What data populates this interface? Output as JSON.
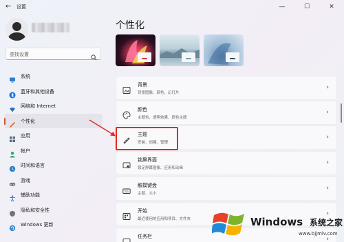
{
  "window": {
    "title": "设置",
    "back_icon": "back-arrow-icon",
    "controls": [
      "minimize",
      "maximize",
      "close"
    ]
  },
  "sidebar": {
    "search_placeholder": "查找设置",
    "items": [
      {
        "label": "系统",
        "icon": "system-icon",
        "color": "#2f7dd1"
      },
      {
        "label": "蓝牙和其他设备",
        "icon": "bluetooth-icon",
        "color": "#1f6fd1"
      },
      {
        "label": "网络和 Internet",
        "icon": "wifi-icon",
        "color": "#2a6fbf"
      },
      {
        "label": "个性化",
        "icon": "brush-icon",
        "color": "#d46b2b",
        "active": true
      },
      {
        "label": "应用",
        "icon": "apps-icon",
        "color": "#5a6a7e"
      },
      {
        "label": "帐户",
        "icon": "account-icon",
        "color": "#2fa36b"
      },
      {
        "label": "时间和语言",
        "icon": "globe-clock-icon",
        "color": "#2a7fc9"
      },
      {
        "label": "游戏",
        "icon": "gamepad-icon",
        "color": "#6b7280"
      },
      {
        "label": "辅助功能",
        "icon": "accessibility-icon",
        "color": "#2c7be5"
      },
      {
        "label": "隐私和安全性",
        "icon": "shield-icon",
        "color": "#6b7280"
      },
      {
        "label": "Windows 更新",
        "icon": "windows-update-icon",
        "color": "#2b88d8"
      }
    ]
  },
  "main": {
    "title": "个性化",
    "cards": [
      {
        "title": "背景",
        "subtitle": "背景图像、颜色、幻灯片",
        "icon": "image-icon"
      },
      {
        "title": "颜色",
        "subtitle": "主题色、透明效果、颜色主题",
        "icon": "palette-icon"
      },
      {
        "title": "主题",
        "subtitle": "安装、创建、管理",
        "icon": "brush-icon"
      },
      {
        "title": "锁屏界面",
        "subtitle": "锁定屏幕图像、应用和动画",
        "icon": "lock-screen-icon"
      },
      {
        "title": "触摸键盘",
        "subtitle": "主题、大小",
        "icon": "keyboard-icon"
      },
      {
        "title": "开始",
        "subtitle": "最近使用的应用和项目、文件夹",
        "icon": "start-icon"
      },
      {
        "title": "任务栏",
        "subtitle": "",
        "icon": "taskbar-icon"
      }
    ],
    "accent_annotation": "#e02a1f"
  },
  "watermark": {
    "brand": "Windows",
    "tagline": "系统之家",
    "url": "www.bjjmlv.com"
  }
}
